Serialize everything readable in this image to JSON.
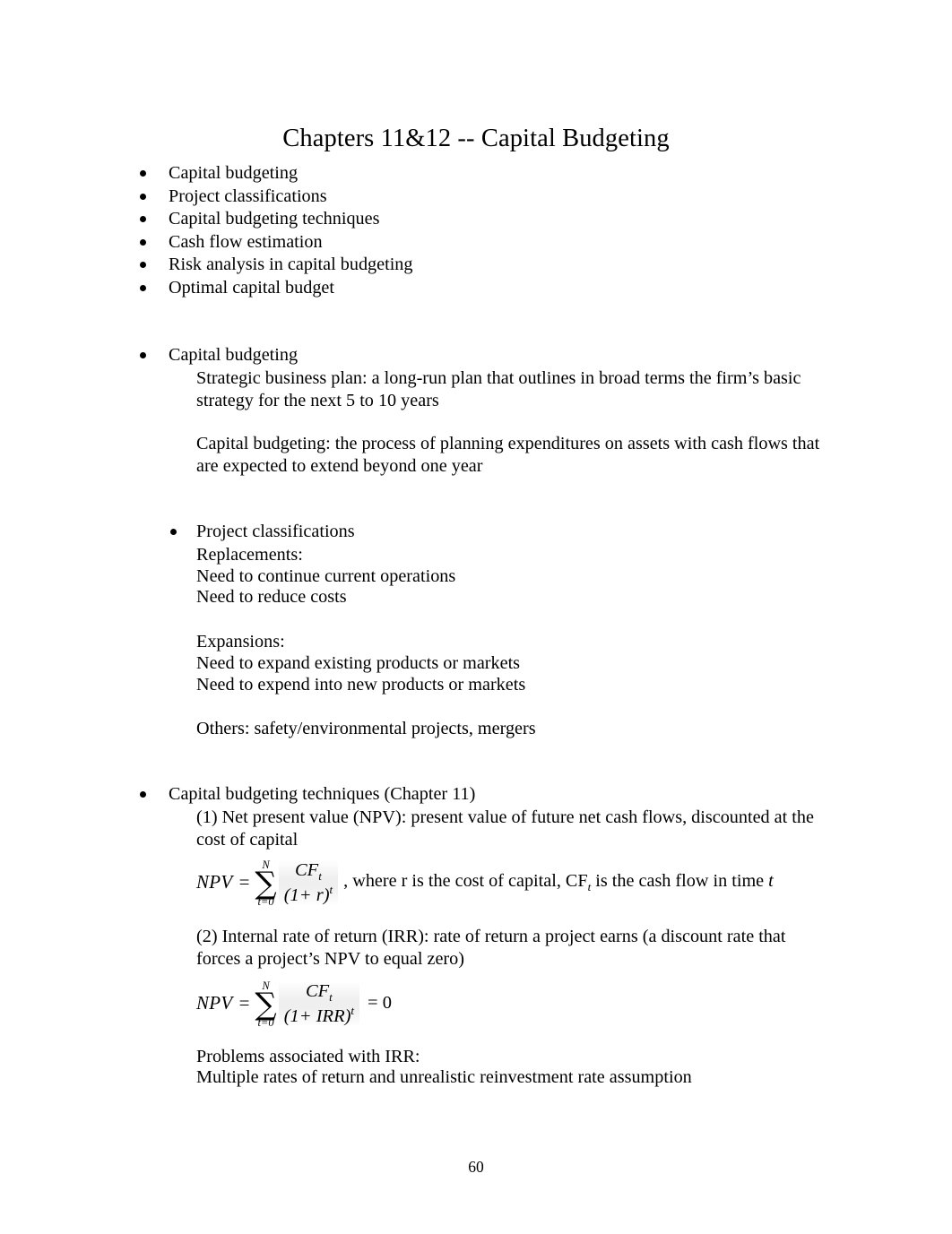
{
  "document": {
    "title": "Chapters 11&12 -- Capital Budgeting",
    "page_number": "60"
  },
  "outline": {
    "items": [
      "Capital budgeting",
      "Project classifications",
      "Capital budgeting techniques",
      "Cash flow estimation",
      "Risk analysis in capital budgeting",
      "Optimal capital budget"
    ]
  },
  "section_capital_budgeting": {
    "heading": "Capital budgeting",
    "strategic_plan": "Strategic business plan: a long-run plan that outlines in broad terms the firm’s basic strategy for the next 5 to 10 years",
    "definition": "Capital budgeting: the process of planning expenditures on assets with cash flows that are expected to extend beyond one year"
  },
  "section_project_classifications": {
    "heading": "Project classifications",
    "replacements_label": "Replacements:",
    "replacements_items": [
      "Need to continue current operations",
      "Need to reduce costs"
    ],
    "expansions_label": "Expansions:",
    "expansions_items": [
      "Need to expand existing products or markets",
      "Need to expend into new products or markets"
    ],
    "others": "Others: safety/environmental projects, mergers"
  },
  "section_techniques": {
    "heading": "Capital budgeting techniques (Chapter 11)",
    "npv_description": "(1) Net present value (NPV): present value of future net cash flows, discounted at the cost of capital",
    "npv_equation": {
      "lhs": "NPV",
      "equals": "=",
      "sum_upper": "N",
      "sum_lower": "t=0",
      "sigma": "∑",
      "numerator": "CF",
      "numerator_sub": "t",
      "denominator": "(1+ r)",
      "denominator_sup": "t",
      "tail": ", where r is the cost of capital, CF",
      "tail_sub": "t",
      "tail_rest": " is the cash flow in time ",
      "tail_italic": "t"
    },
    "irr_description": "(2) Internal rate of return (IRR): rate of return a project earns (a discount rate that forces a project’s NPV to equal zero)",
    "irr_equation": {
      "lhs": "NPV",
      "equals": "=",
      "sum_upper": "N",
      "sum_lower": "t=0",
      "sigma": "∑",
      "numerator": "CF",
      "numerator_sub": "t",
      "denominator": "(1+ IRR)",
      "denominator_sup": "t",
      "result": "= 0"
    },
    "irr_problems_label": "Problems associated with IRR:",
    "irr_problems_text": "Multiple rates of return and unrealistic reinvestment rate assumption"
  }
}
